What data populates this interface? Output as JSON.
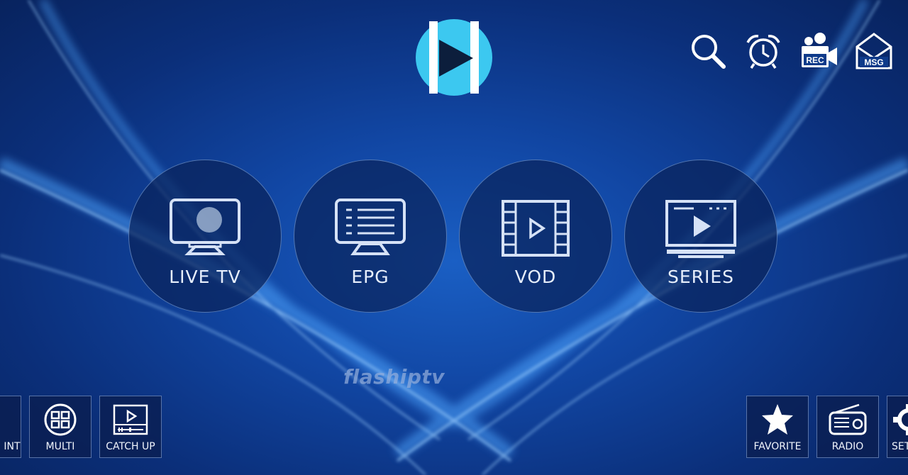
{
  "main_menu": [
    {
      "label": "LIVE TV",
      "icon": "tv-icon"
    },
    {
      "label": "EPG",
      "icon": "epg-list-icon"
    },
    {
      "label": "VOD",
      "icon": "film-play-icon"
    },
    {
      "label": "SERIES",
      "icon": "series-screen-icon"
    }
  ],
  "top_bar": {
    "rec_badge": "REC",
    "msg_badge": "MSG"
  },
  "watermark": "flashiptv",
  "bottom_left": {
    "account_label": "INT",
    "multi_label": "MULTI",
    "catchup_label": "CATCH UP"
  },
  "bottom_right": {
    "favorite_label": "FAVORITE",
    "radio_label": "RADIO",
    "settings_label": "SET"
  },
  "colors": {
    "logo_cyan": "#3cc8f0",
    "logo_dark": "#0c1e3c",
    "bg_blue": "#1146a3"
  }
}
